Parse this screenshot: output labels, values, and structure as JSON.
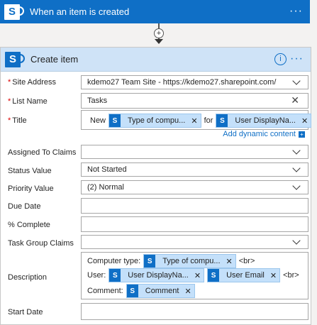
{
  "trigger": {
    "title": "When an item is created",
    "logo": "S"
  },
  "action": {
    "title": "Create item",
    "logo": "S",
    "info_glyph": "i",
    "more_glyph": "···"
  },
  "fields": {
    "site_address": {
      "label": "Site Address",
      "value": "kdemo27 Team Site - https://kdemo27.sharepoint.com/"
    },
    "list_name": {
      "label": "List Name",
      "value": "Tasks"
    },
    "title": {
      "label": "Title",
      "prefix": "New",
      "token1": "Type of compu...",
      "middle": "for",
      "token2": "User DisplayNa..."
    },
    "dynamic_content_link": "Add dynamic content",
    "assigned_to_claims": {
      "label": "Assigned To Claims",
      "value": ""
    },
    "status_value": {
      "label": "Status Value",
      "value": "Not Started"
    },
    "priority_value": {
      "label": "Priority Value",
      "value": "(2) Normal"
    },
    "due_date": {
      "label": "Due Date",
      "value": ""
    },
    "percent_complete": {
      "label": "% Complete",
      "value": ""
    },
    "task_group_claims": {
      "label": "Task Group Claims",
      "value": ""
    },
    "description": {
      "label": "Description",
      "line1_prefix": "Computer type:",
      "line1_token": "Type of compu...",
      "line1_suffix": "<br>",
      "line2_prefix": "User:",
      "line2_token1": "User DisplayNa...",
      "line2_token2": "User Email",
      "line2_suffix": "<br>",
      "line3_prefix": "Comment:",
      "line3_token": "Comment"
    },
    "start_date": {
      "label": "Start Date",
      "value": ""
    }
  },
  "colors": {
    "sharepoint_blue": "#0f6fc6",
    "header_bg": "#cfe3f7",
    "token_bg": "#c4e0fa",
    "required": "#d00000"
  },
  "icons": [
    "sharepoint-icon",
    "plus-icon",
    "arrow-down-icon",
    "info-icon",
    "more-icon",
    "chevron-down-icon",
    "close-icon"
  ]
}
